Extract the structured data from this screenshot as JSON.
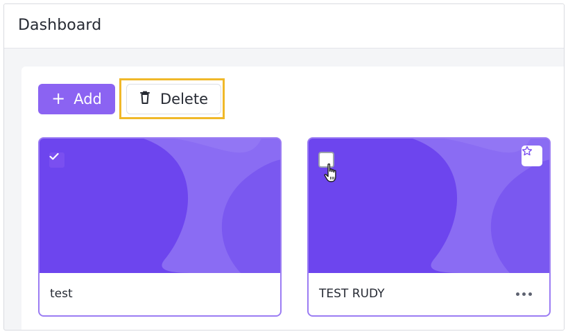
{
  "header": {
    "title": "Dashboard"
  },
  "toolbar": {
    "add_label": "Add",
    "delete_label": "Delete"
  },
  "cards": [
    {
      "name": "test",
      "selected": true,
      "favorite_visible": false,
      "more_visible": false
    },
    {
      "name": "TEST RUDY",
      "selected": false,
      "favorite_visible": true,
      "more_visible": true
    }
  ],
  "colors": {
    "accent": "#8b63f2",
    "thumbnail": "#6f46ef",
    "highlight": "#f0b829",
    "card_border": "#9b7cf3"
  },
  "icons": {
    "add": "plus-icon",
    "delete": "trash-icon",
    "selected": "check-icon",
    "favorite": "star-icon",
    "more": "more-horizontal-icon",
    "pointer": "hand-pointer-icon"
  }
}
